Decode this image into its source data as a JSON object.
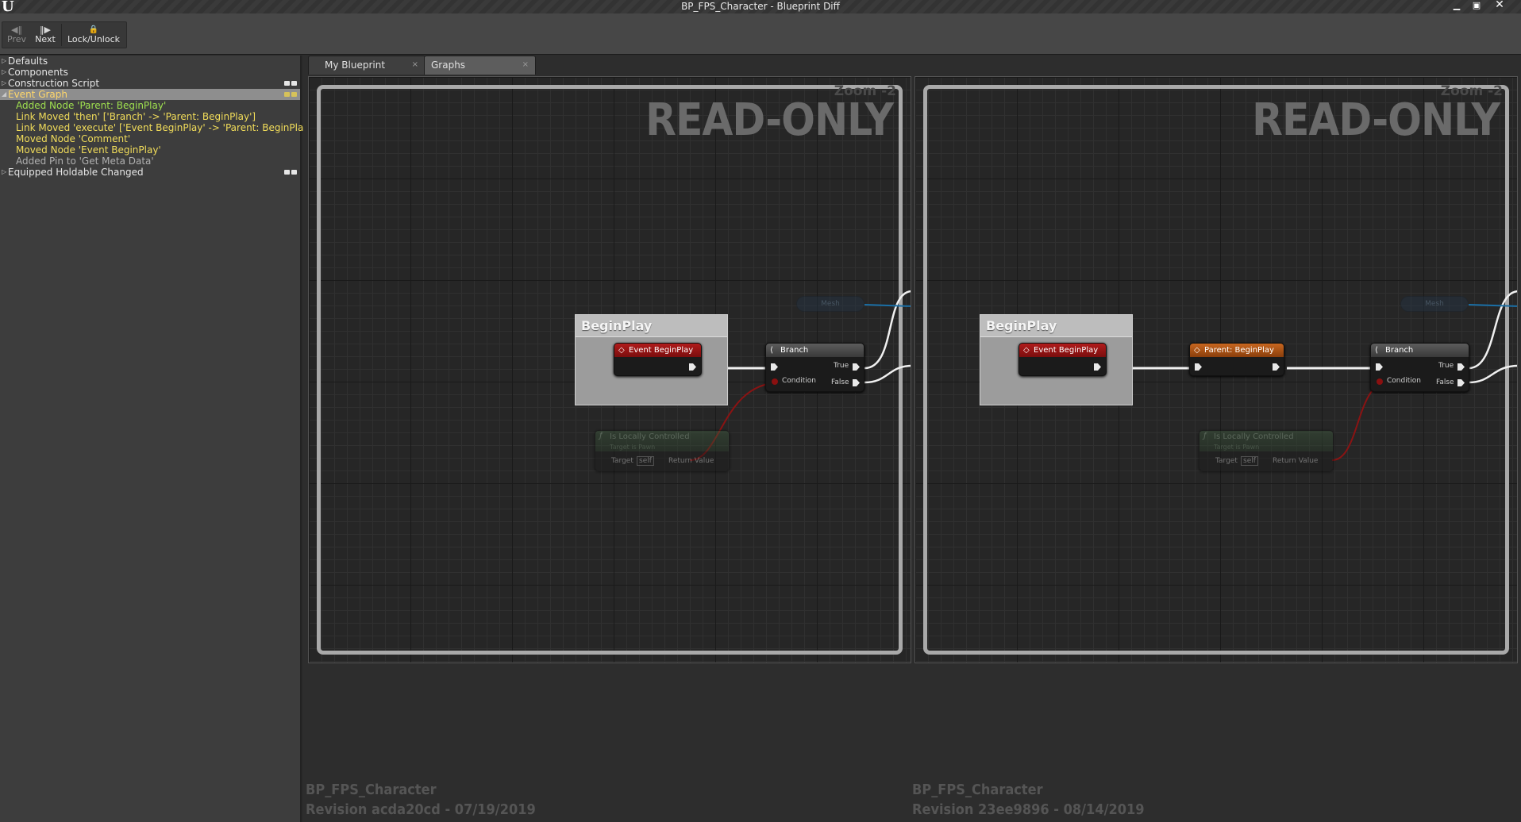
{
  "window": {
    "title": "BP_FPS_Character - Blueprint Diff",
    "logo": "U",
    "controls": {
      "minimize": "▁",
      "maximize": "▣",
      "close": "✕"
    }
  },
  "toolbar": {
    "prev": {
      "label": "Prev",
      "icon": "◀‖"
    },
    "next": {
      "label": "Next",
      "icon": "‖▶"
    },
    "lock": {
      "label": "Lock/Unlock",
      "icon": "🔒"
    }
  },
  "tree": {
    "defaults": "Defaults",
    "components": "Components",
    "construction_script": "Construction Script",
    "event_graph": "Event Graph",
    "changes": [
      {
        "text": "Added Node 'Parent: BeginPlay'",
        "color": "green"
      },
      {
        "text": "Link Moved  'then' ['Branch' -> 'Parent: BeginPlay']",
        "color": "yellow"
      },
      {
        "text": "Link Moved  'execute' ['Event BeginPlay' -> 'Parent: BeginPlay']",
        "color": "yellow"
      },
      {
        "text": "Moved Node 'Comment'",
        "color": "yellow"
      },
      {
        "text": "Moved Node 'Event BeginPlay'",
        "color": "yellow"
      },
      {
        "text": "Added Pin to 'Get Meta Data'",
        "color": "gray"
      }
    ],
    "equipped": "Equipped Holdable Changed"
  },
  "tabs": {
    "my_blueprint": "My Blueprint",
    "graphs": "Graphs",
    "close": "×"
  },
  "graph": {
    "zoom": "Zoom -2",
    "read_only": "READ-ONLY",
    "comment_title": "BeginPlay",
    "event_begin_play": "Event BeginPlay",
    "parent_begin_play": "Parent: BeginPlay",
    "branch": "Branch",
    "true": "True",
    "false": "False",
    "condition": "Condition",
    "is_locally_controlled": "Is Locally Controlled",
    "target_is_pawn": "Target is Pawn",
    "target": "Target",
    "self": "self",
    "return_value": "Return Value",
    "mesh": "Mesh"
  },
  "revisions": {
    "left": {
      "name": "BP_FPS_Character",
      "revision": "Revision acda20cd - 07/19/2019"
    },
    "right": {
      "name": "BP_FPS_Character",
      "revision": "Revision 23ee9896 - 08/14/2019"
    }
  }
}
